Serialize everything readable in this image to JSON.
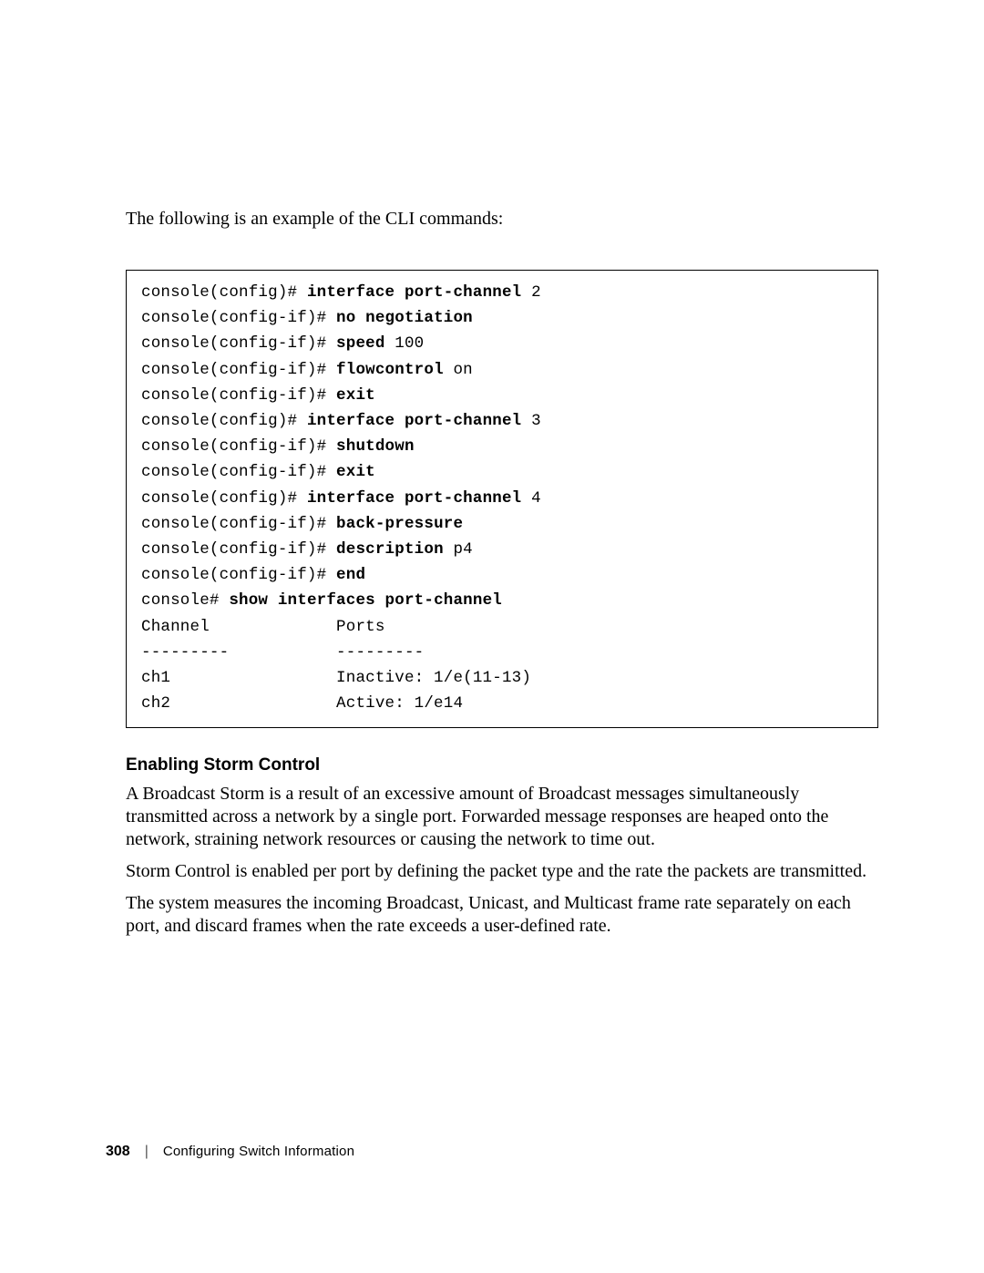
{
  "intro": "The following is an example of the CLI commands:",
  "cli": [
    {
      "prompt": "console(config)# ",
      "bold": "interface port-channel",
      "tail": " 2"
    },
    {
      "prompt": "console(config-if)# ",
      "bold": "no negotiation",
      "tail": ""
    },
    {
      "prompt": "console(config-if)# ",
      "bold": "speed",
      "tail": " 100"
    },
    {
      "prompt": "console(config-if)# ",
      "bold": "flowcontrol",
      "tail": " on"
    },
    {
      "prompt": "console(config-if)# ",
      "bold": "exit",
      "tail": ""
    },
    {
      "prompt": "console(config)# ",
      "bold": "interface port-channel",
      "tail": " 3"
    },
    {
      "prompt": "console(config-if)# ",
      "bold": "shutdown",
      "tail": ""
    },
    {
      "prompt": "console(config-if)# ",
      "bold": "exit",
      "tail": ""
    },
    {
      "prompt": "console(config)# ",
      "bold": "interface port-channel",
      "tail": " 4"
    },
    {
      "prompt": "console(config-if)# ",
      "bold": "back-pressure",
      "tail": ""
    },
    {
      "prompt": "console(config-if)# ",
      "bold": "description",
      "tail": " p4"
    },
    {
      "prompt": "console(config-if)# ",
      "bold": "end",
      "tail": ""
    },
    {
      "prompt": "console# ",
      "bold": "show interfaces port-channel",
      "tail": ""
    },
    {
      "plain": "Channel             Ports"
    },
    {
      "plain": "---------           ---------"
    },
    {
      "plain": "ch1                 Inactive: 1/e(11-13)"
    },
    {
      "plain": "ch2                 Active: 1/e14"
    }
  ],
  "section_heading": "Enabling Storm Control",
  "paragraphs": [
    "A Broadcast Storm is a result of an excessive amount of Broadcast messages simultaneously transmitted across a network by a single port. Forwarded message responses are heaped onto the network, straining network resources or causing the network to time out.",
    "Storm Control is enabled per port by defining the packet type and the rate the packets are transmitted.",
    "The system measures the incoming Broadcast, Unicast, and Multicast frame rate separately on each port, and discard frames when the rate exceeds a user-defined rate."
  ],
  "footer": {
    "page_number": "308",
    "divider": "|",
    "section_title": "Configuring Switch Information"
  }
}
